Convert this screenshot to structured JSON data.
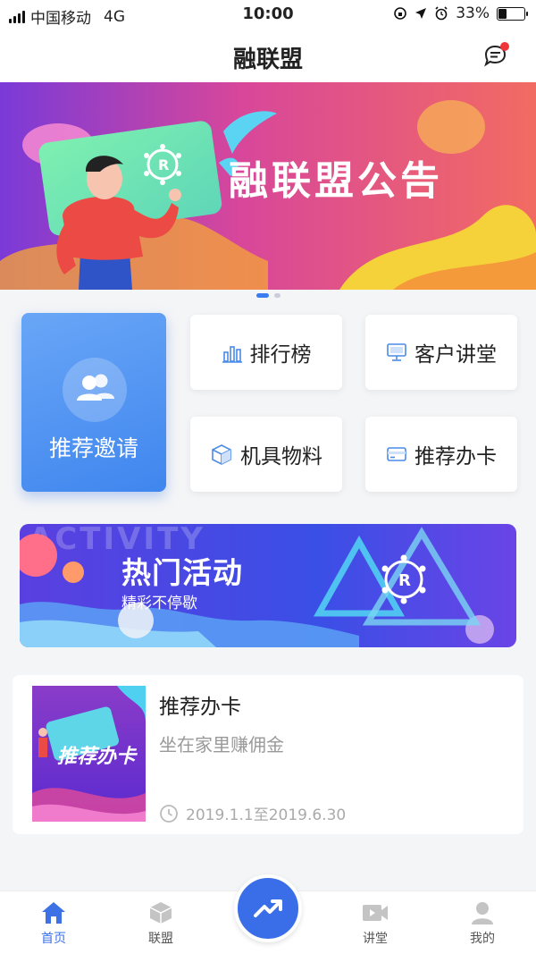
{
  "status_bar": {
    "carrier": "中国移动",
    "network": "4G",
    "time": "10:00",
    "battery": "33%",
    "battery_level": 0.33
  },
  "nav": {
    "title": "融联盟"
  },
  "banner": {
    "headline": "融联盟公告",
    "slide_count": 2,
    "active_slide": 1
  },
  "grid": {
    "invite_label": "推荐邀请",
    "tiles": [
      {
        "label": "排行榜",
        "icon": "bar-chart-icon"
      },
      {
        "label": "客户讲堂",
        "icon": "monitor-icon"
      },
      {
        "label": "机具物料",
        "icon": "box-icon"
      },
      {
        "label": "推荐办卡",
        "icon": "card-icon"
      }
    ]
  },
  "activity": {
    "bg_text": "ACTIVITY",
    "title": "热门活动",
    "subtitle": "精彩不停歇"
  },
  "news": {
    "thumb_text": "推荐办卡",
    "title": "推荐办卡",
    "desc": "坐在家里赚佣金",
    "date": "2019.1.1至2019.6.30"
  },
  "tabbar": {
    "home": "首页",
    "league": "联盟",
    "lecture": "讲堂",
    "mine": "我的"
  },
  "colors": {
    "accent": "#3a6ee8",
    "badge": "#f0353a"
  }
}
